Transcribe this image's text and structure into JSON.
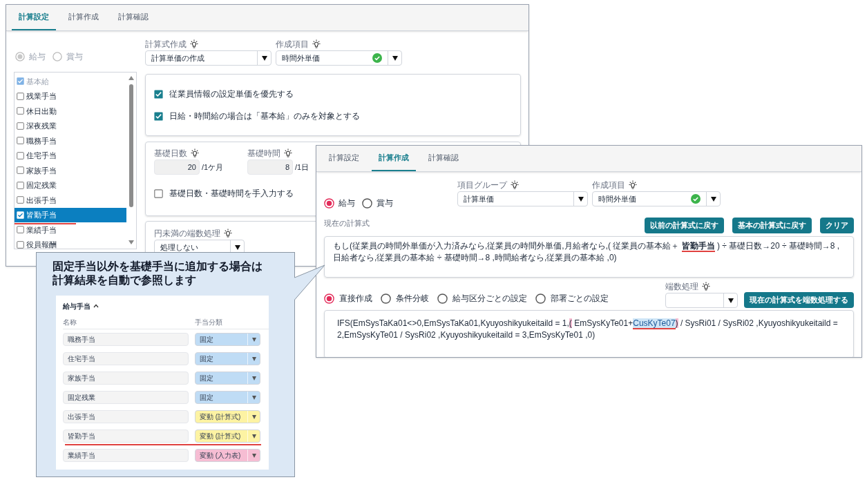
{
  "settings_window": {
    "tabs": [
      {
        "label": "計算設定",
        "selected": true
      },
      {
        "label": "計算作成",
        "selected": false
      },
      {
        "label": "計算確認",
        "selected": false
      }
    ],
    "pay_types": {
      "disabled": true,
      "options": [
        {
          "label": "給与",
          "selected": true
        },
        {
          "label": "賞与",
          "selected": false
        }
      ]
    },
    "allowances": [
      {
        "label": "基本給",
        "checked": true,
        "selected": false,
        "disabled": true,
        "highlighted": false
      },
      {
        "label": "残業手当",
        "checked": false,
        "selected": false,
        "disabled": false,
        "highlighted": false
      },
      {
        "label": "休日出勤",
        "checked": false,
        "selected": false,
        "disabled": false,
        "highlighted": false
      },
      {
        "label": "深夜残業",
        "checked": false,
        "selected": false,
        "disabled": false,
        "highlighted": false
      },
      {
        "label": "職務手当",
        "checked": false,
        "selected": false,
        "disabled": false,
        "highlighted": false
      },
      {
        "label": "住宅手当",
        "checked": false,
        "selected": false,
        "disabled": false,
        "highlighted": false
      },
      {
        "label": "家族手当",
        "checked": false,
        "selected": false,
        "disabled": false,
        "highlighted": false
      },
      {
        "label": "固定残業",
        "checked": false,
        "selected": false,
        "disabled": false,
        "highlighted": false
      },
      {
        "label": "出張手当",
        "checked": false,
        "selected": false,
        "disabled": false,
        "highlighted": false
      },
      {
        "label": "皆勤手当",
        "checked": true,
        "selected": true,
        "disabled": false,
        "highlighted": true
      },
      {
        "label": "業績手当",
        "checked": false,
        "selected": false,
        "disabled": false,
        "highlighted": false
      },
      {
        "label": "役員報酬",
        "checked": false,
        "selected": false,
        "disabled": false,
        "highlighted": false
      }
    ],
    "formula_type": {
      "label": "計算式作成",
      "value": "計算単価の作成"
    },
    "target_item": {
      "label": "作成項目",
      "value": "時間外単価",
      "valid": true
    },
    "options": [
      {
        "label": "従業員情報の設定単価を優先する",
        "checked": true
      },
      {
        "label": "日給・時間給の場合は「基本給」のみを対象とする",
        "checked": true
      }
    ],
    "base_days": {
      "label": "基礎日数",
      "value": "20",
      "unit": "/1ケ月"
    },
    "base_hours": {
      "label": "基礎時間",
      "value": "8",
      "unit": "/1日"
    },
    "manual_input": {
      "label": "基礎日数・基礎時間を手入力する",
      "checked": false
    },
    "rounding": {
      "label": "円未満の端数処理",
      "value": "処理しない"
    }
  },
  "callout": {
    "lines": [
      "固定手当以外を基礎手当に追加する場合は",
      "計算結果を自動で参照します"
    ],
    "panel": {
      "title": "給与手当",
      "expanded": true,
      "columns": [
        "名称",
        "手当分類"
      ],
      "rows": [
        {
          "name": "職務手当",
          "category": "固定",
          "color": "#bfdcf5",
          "highlighted": false
        },
        {
          "name": "住宅手当",
          "category": "固定",
          "color": "#bfdcf5",
          "highlighted": false
        },
        {
          "name": "家族手当",
          "category": "固定",
          "color": "#bfdcf5",
          "highlighted": false
        },
        {
          "name": "固定残業",
          "category": "固定",
          "color": "#bfdcf5",
          "highlighted": false
        },
        {
          "name": "出張手当",
          "category": "変動 (計算式)",
          "color": "#fdf3a3",
          "highlighted": false
        },
        {
          "name": "皆勤手当",
          "category": "変動 (計算式)",
          "color": "#fdf3a3",
          "highlighted": true
        },
        {
          "name": "業績手当",
          "category": "変動 (入力表)",
          "color": "#f6bdd3",
          "highlighted": false
        }
      ]
    }
  },
  "formula_window": {
    "tabs": [
      {
        "label": "計算設定",
        "selected": false
      },
      {
        "label": "計算作成",
        "selected": true
      },
      {
        "label": "計算確認",
        "selected": false
      }
    ],
    "pay_types": {
      "disabled": false,
      "options": [
        {
          "label": "給与",
          "selected": true
        },
        {
          "label": "賞与",
          "selected": false
        }
      ]
    },
    "item_group": {
      "label": "項目グループ",
      "value": "計算単価"
    },
    "target_item": {
      "label": "作成項目",
      "value": "時間外単価",
      "valid": true
    },
    "current_formula_label": "現在の計算式",
    "buttons": [
      "以前の計算式に戻す",
      "基本の計算式に戻す",
      "クリア"
    ],
    "current_formula": [
      {
        "kind": "plain",
        "text": "もし(従業員の時間外単価が入力済みなら,従業員の時間外単価,月給者なら,( 従業員の基本給＋ "
      },
      {
        "kind": "underline",
        "text": "皆勤手当"
      },
      {
        "kind": "plain",
        "text": " ) ÷ 基礎日数→20 ÷ 基礎時間→8 ,日給者なら,従業員の基本給 ÷ 基礎時間→8 ,時間給者なら,従業員の基本給 ,0)"
      }
    ],
    "modes": [
      {
        "label": "直接作成",
        "selected": true
      },
      {
        "label": "条件分岐",
        "selected": false
      },
      {
        "label": "給与区分ごとの設定",
        "selected": false
      },
      {
        "label": "部署ごとの設定",
        "selected": false
      }
    ],
    "rounding": {
      "label": "端数処理"
    },
    "rounding_button": "現在の計算式を端数処理する",
    "expression": [
      {
        "kind": "plain",
        "text": "IFS(EmSysTaKa01<>0,EmSysTaKa01,Kyuyoshikyukeitaild = 1,"
      },
      {
        "kind": "paren",
        "text": "("
      },
      {
        "kind": "plain",
        "text": " EmSysKyTe01+"
      },
      {
        "kind": "token",
        "text": "CusKyTe07"
      },
      {
        "kind": "paren",
        "text": ")"
      },
      {
        "kind": "plain",
        "text": " / SysRi01 / SysRi02 ,Kyuyoshikyukeitaild = 2,EmSysKyTe01 / SysRi02 ,Kyuyoshikyukeitaild = 3,EmSysKyTe01 ,0)"
      }
    ]
  }
}
